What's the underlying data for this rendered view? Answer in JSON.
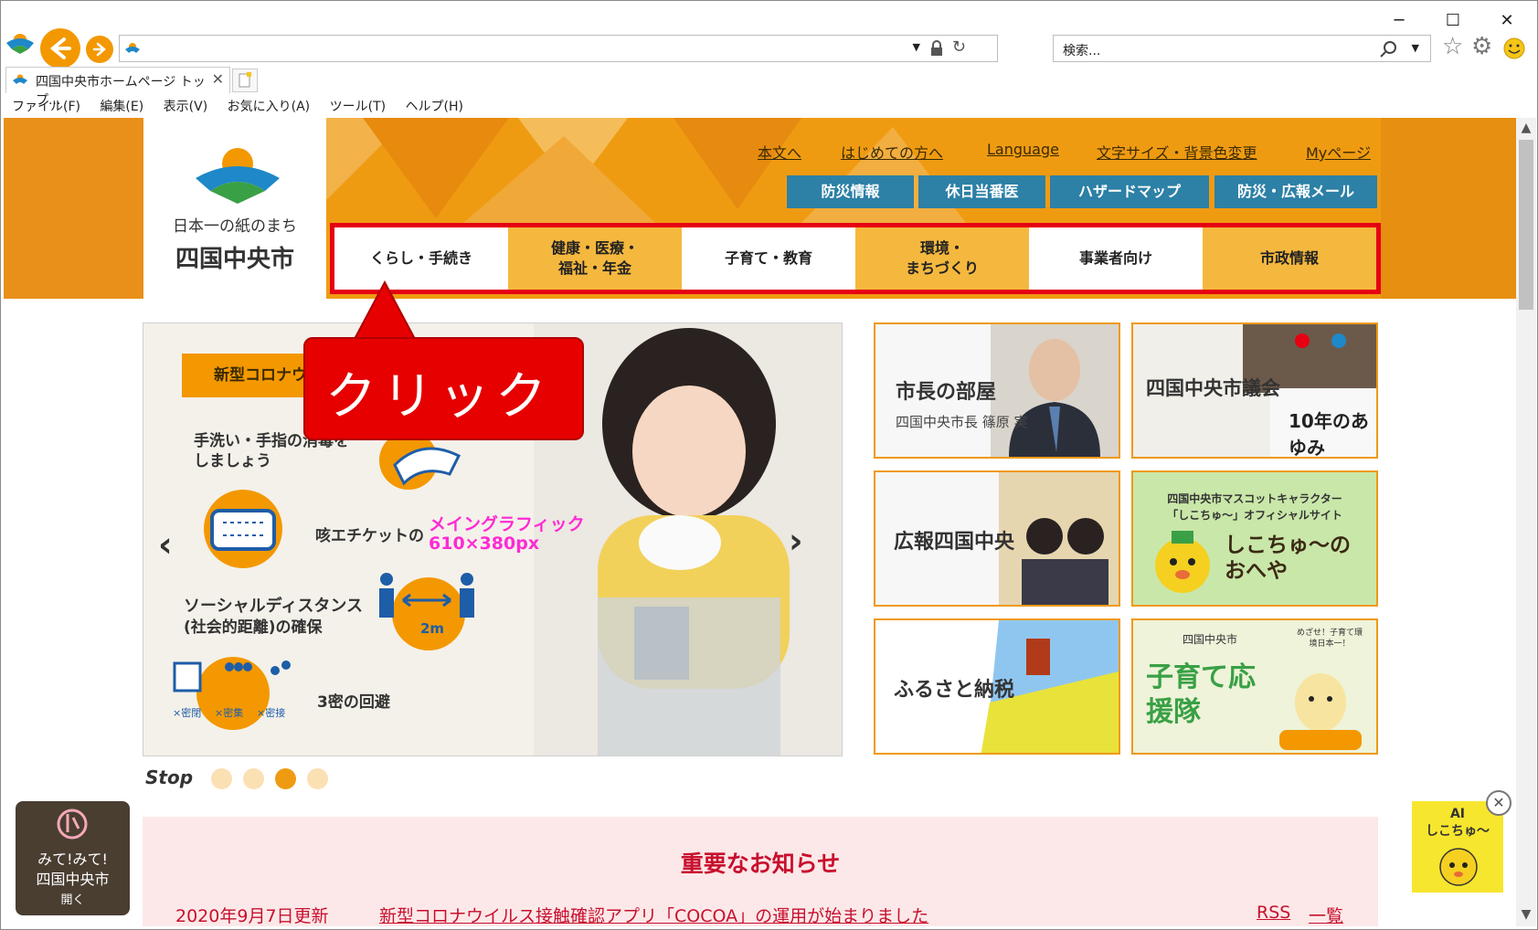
{
  "browser": {
    "search_placeholder": "検索...",
    "tab_title": "四国中央市ホームページ トップ...",
    "menu": [
      "ファイル(F)",
      "編集(E)",
      "表示(V)",
      "お気に入り(A)",
      "ツール(T)",
      "ヘルプ(H)"
    ]
  },
  "site": {
    "tagline": "日本一の紙のまち",
    "city_name": "四国中央市",
    "top_links": [
      "本文へ",
      "はじめての方へ",
      "Language",
      "文字サイズ・背景色変更",
      "Myページ"
    ],
    "blue_buttons": [
      "防災情報",
      "休日当番医",
      "ハザードマップ",
      "防災・広報メール"
    ],
    "nav": [
      {
        "line1": "くらし・手続き",
        "line2": ""
      },
      {
        "line1": "健康・医療・",
        "line2": "福祉・年金"
      },
      {
        "line1": "子育て・教育",
        "line2": ""
      },
      {
        "line1": "環境・",
        "line2": "まちづくり"
      },
      {
        "line1": "事業者向け",
        "line2": ""
      },
      {
        "line1": "市政情報",
        "line2": ""
      }
    ]
  },
  "callout": {
    "text": "クリック"
  },
  "slider": {
    "tag": "新型コロナウ",
    "lines": {
      "hand": "手洗い・手指の消毒を\nしましょう",
      "cough": "咳エチケットの",
      "distance1": "ソーシャルディスタンス",
      "distance2": "(社会的距離)の確保",
      "dist_label": "2m",
      "sanmitsu": "3密の回避",
      "mitsu_labels": [
        "×密閉",
        "×密集",
        "×密接"
      ]
    },
    "main_graphic_1": "メイングラフィック",
    "main_graphic_2": "610×380px",
    "prev": "‹",
    "next": "›",
    "stop_label": "Stop",
    "active_dot": 3
  },
  "banners": [
    {
      "title": "市長の部屋",
      "sub": "四国中央市長 篠原 実"
    },
    {
      "title": "四国中央市議会",
      "sub": "10年のあゆみ"
    },
    {
      "title": "広報四国中央",
      "sub": ""
    },
    {
      "title": "四国中央市マスコットキャラクター",
      "sub": "「しこちゅ～」オフィシャルサイト",
      "big": "しこちゅ～の\nおへや"
    },
    {
      "title": "ふるさと納税",
      "sub": ""
    },
    {
      "title": "四国中央市",
      "sub": "子育て応援隊",
      "extra": "めざせ！子育て環境日本一！"
    }
  ],
  "notice": {
    "heading": "重要なお知らせ",
    "date": "2020年9月7日更新",
    "link": "新型コロナウイルス接触確認アプリ「COCOA」の運用が始まりました",
    "rss": "RSS",
    "list": "一覧"
  },
  "widgets": {
    "mitemite_1": "みて!みて!",
    "mitemite_2": "四国中央市",
    "mitemite_open": "開く",
    "ai_1": "AI",
    "ai_2": "しこちゅ～"
  },
  "colors": {
    "accent": "#ef9b12",
    "nav_orange": "#f5b83e",
    "blue_btn": "#2d80a6",
    "red": "#e60012",
    "notice_bg": "#fce8e8",
    "notice_head": "#c8102e"
  }
}
